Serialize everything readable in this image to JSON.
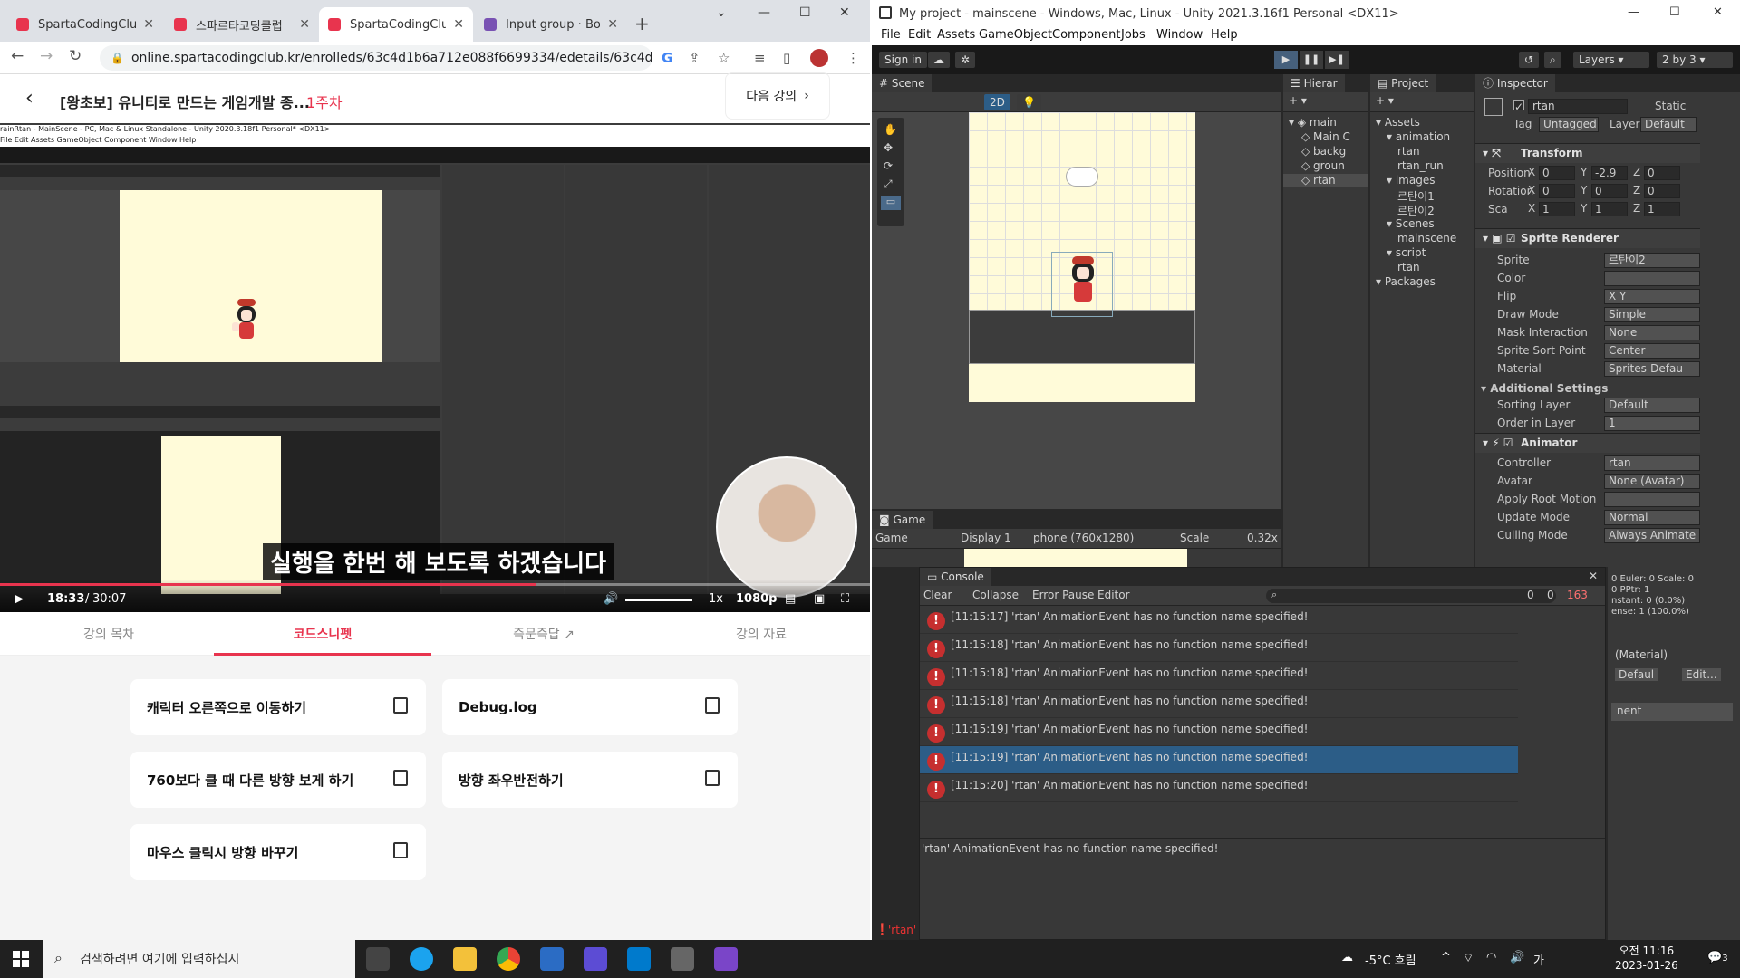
{
  "browser": {
    "tabs": [
      {
        "label": "SpartaCodingClub",
        "color": "#e8344e"
      },
      {
        "label": "스파르타코딩클럽",
        "color": "#e8344e"
      },
      {
        "label": "SpartaCodingClub",
        "color": "#e8344e"
      },
      {
        "label": "Input group · Boot",
        "color": "#7952b3"
      }
    ],
    "url": "online.spartacodingclub.kr/enrolleds/63c4d1b6a712e088f6699334/edetails/63c4d1b6a71..."
  },
  "lecture": {
    "title": "[왕초보] 유니티로 만드는 게임개발 종...",
    "week": "1주차",
    "next_label": "다음 강의",
    "subtitle": "실행을 한번 해 보도록 하겠습니다",
    "time_current": "18:33",
    "time_sep": "/",
    "time_total": "30:07",
    "speed": "1x",
    "quality": "1080p",
    "progress": 0.616,
    "mini_title": "rainRtan - MainScene - PC, Mac & Linux Standalone - Unity 2020.3.18f1 Personal* <DX11>",
    "mini_menu": "File  Edit  Assets  GameObject  Component  Window  Help",
    "tabs": [
      "강의 목차",
      "코드스니펫",
      "즉문즉답",
      "강의 자료"
    ],
    "snippets": [
      "캐릭터 오른쪽으로 이동하기",
      "Debug.log",
      "760보다 클 때 다른 방향 보게 하기",
      "방향 좌우반전하기",
      "마우스 클릭시 방향 바꾸기"
    ]
  },
  "unity": {
    "title": "My project - mainscene - Windows, Mac, Linux - Unity 2021.3.16f1 Personal <DX11>",
    "menu": [
      "File",
      "Edit",
      "Assets",
      "GameObject",
      "Component",
      "Jobs",
      "Window",
      "Help"
    ],
    "sign_in": "Sign in",
    "layers": "Layers",
    "layout": "2 by 3",
    "scene_tab": "Scene",
    "scene_2d": "2D",
    "hierarchy_tab": "Hierar",
    "hierarchy": [
      "main",
      "Main C",
      "backg",
      "groun",
      "rtan"
    ],
    "project_tab": "Project",
    "project_tree": [
      {
        "label": "Assets",
        "level": 0
      },
      {
        "label": "animation",
        "level": 1
      },
      {
        "label": "rtan",
        "level": 2
      },
      {
        "label": "rtan_run",
        "level": 2
      },
      {
        "label": "images",
        "level": 1
      },
      {
        "label": "르탄이1",
        "level": 2
      },
      {
        "label": "르탄이2",
        "level": 2
      },
      {
        "label": "Scenes",
        "level": 1
      },
      {
        "label": "mainscene",
        "level": 2
      },
      {
        "label": "script",
        "level": 1
      },
      {
        "label": "rtan",
        "level": 2
      },
      {
        "label": "Packages",
        "level": 0
      }
    ],
    "inspector": {
      "tab": "Inspector",
      "name": "rtan",
      "static": "Static",
      "tag_label": "Tag",
      "tag": "Untagged",
      "layer_label": "Layer",
      "layer": "Default",
      "transform": "Transform",
      "position": "Position",
      "rotation": "Rotation",
      "scale": "Sca",
      "pos": [
        "0",
        "-2.9",
        "0"
      ],
      "rot": [
        "0",
        "0",
        "0"
      ],
      "scl": [
        "1",
        "1",
        "1"
      ],
      "sprite_renderer": "Sprite Renderer",
      "rows": [
        {
          "label": "Sprite",
          "value": "르탄이2"
        },
        {
          "label": "Color",
          "value": ""
        },
        {
          "label": "Flip",
          "value": "X  Y"
        },
        {
          "label": "Draw Mode",
          "value": "Simple"
        },
        {
          "label": "Mask Interaction",
          "value": "None"
        },
        {
          "label": "Sprite Sort Point",
          "value": "Center"
        },
        {
          "label": "Material",
          "value": "Sprites-Defau"
        }
      ],
      "additional": "Additional Settings",
      "rows2": [
        {
          "label": "Sorting Layer",
          "value": "Default"
        },
        {
          "label": "Order in Layer",
          "value": "1"
        }
      ],
      "animator": "Animator",
      "rows3": [
        {
          "label": "Controller",
          "value": "rtan"
        },
        {
          "label": "Avatar",
          "value": "None (Avatar)"
        },
        {
          "label": "Apply Root Motion",
          "value": ""
        },
        {
          "label": "Update Mode",
          "value": "Normal"
        },
        {
          "label": "Culling Mode",
          "value": "Always Animate"
        }
      ],
      "clip_info": "0 Euler: 0 Scale: 0",
      "clip_info2": "0 PPtr: 1",
      "clip_info3": "nstant: 0 (0.0%)",
      "clip_info4": "ense: 1 (100.0%)",
      "material": "(Material)",
      "material_default": "Defaul",
      "material_edit": "Edit...",
      "add_component": "nent"
    },
    "game": {
      "tab": "Game",
      "mode": "Game",
      "display": "Display 1",
      "resolution": "phone (760x1280)",
      "scale_label": "Scale",
      "scale": "0.32x"
    },
    "console": {
      "tab": "Console",
      "clear": "Clear",
      "collapse": "Collapse",
      "error_pause": "Error Pause",
      "editor": "Editor",
      "count_info": "0",
      "count_warn": "0",
      "count_err": "163",
      "logs": [
        {
          "time": "[11:15:17]",
          "msg": "'rtan' AnimationEvent has no function name specified!"
        },
        {
          "time": "[11:15:18]",
          "msg": "'rtan' AnimationEvent has no function name specified!"
        },
        {
          "time": "[11:15:18]",
          "msg": "'rtan' AnimationEvent has no function name specified!"
        },
        {
          "time": "[11:15:18]",
          "msg": "'rtan' AnimationEvent has no function name specified!"
        },
        {
          "time": "[11:15:19]",
          "msg": "'rtan' AnimationEvent has no function name specified!"
        },
        {
          "time": "[11:15:19]",
          "msg": "'rtan' AnimationEvent has no function name specified!"
        },
        {
          "time": "[11:15:20]",
          "msg": "'rtan' AnimationEvent has no function name specified!"
        }
      ],
      "selected": 5,
      "detail": "'rtan' AnimationEvent has no function name specified!"
    },
    "status": "'rtan'"
  },
  "taskbar": {
    "search": "검색하려면 여기에 입력하십시",
    "weather": "-5°C 흐림",
    "time": "오전 11:16",
    "date": "2023-01-26",
    "notif": "3"
  }
}
